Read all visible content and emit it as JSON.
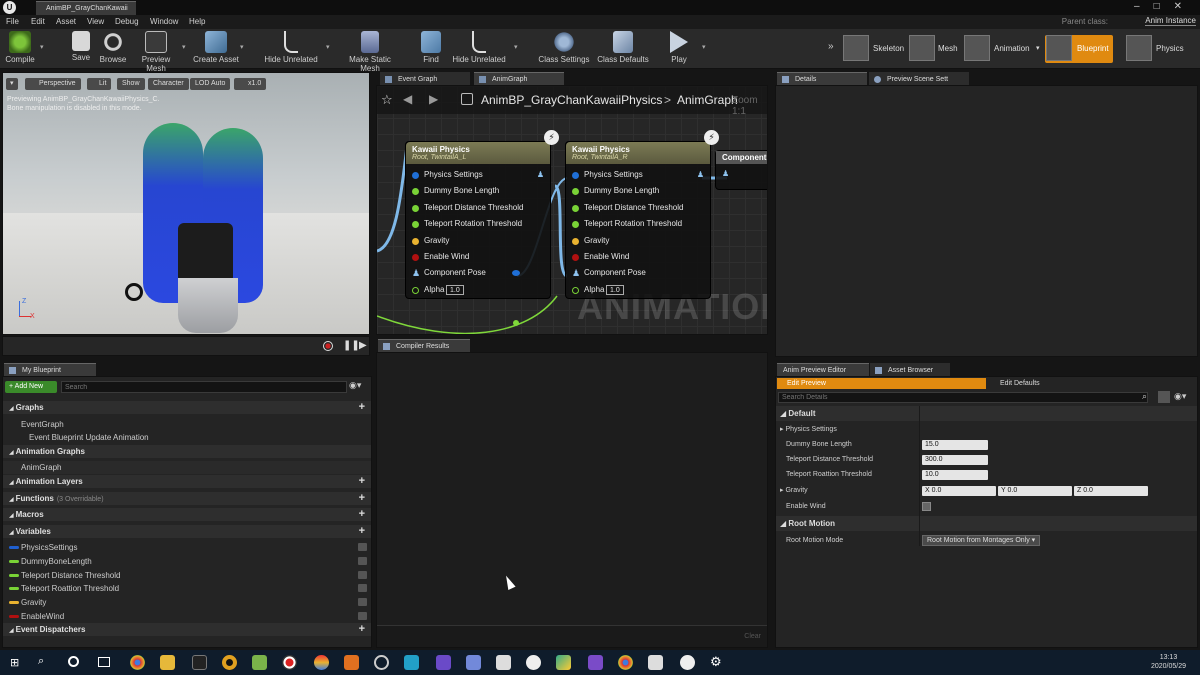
{
  "window": {
    "tab_title": "AnimBP_GrayChanKawaii",
    "parent_class_label": "Parent class:",
    "parent_class_value": "Anim Instance"
  },
  "menu": [
    "File",
    "Edit",
    "Asset",
    "View",
    "Debug",
    "Window",
    "Help"
  ],
  "toolbar": {
    "compile": "Compile",
    "save": "Save",
    "browse": "Browse",
    "preview_mesh": "Preview Mesh",
    "create_asset": "Create Asset",
    "hide_unrelated_1": "Hide Unrelated",
    "make_static_mesh": "Make Static Mesh",
    "find": "Find",
    "hide_unrelated_2": "Hide Unrelated",
    "class_settings": "Class Settings",
    "class_defaults": "Class Defaults",
    "play": "Play"
  },
  "modes": [
    "Skeleton",
    "Mesh",
    "Animation",
    "Blueprint",
    "Physics"
  ],
  "viewport": {
    "chips": [
      "Perspective",
      "Lit",
      "Show",
      "Character",
      "LOD Auto",
      "x1.0"
    ],
    "info_line1": "Previewing AnimBP_GrayChanKawaiiPhysics_C.",
    "info_line2": "Bone manipulation is disabled in this mode.",
    "axis_z": "Z",
    "axis_x": "X"
  },
  "graph": {
    "tab_event": "Event Graph",
    "tab_anim": "AnimGraph",
    "breadcrumb_bp": "AnimBP_GrayChanKawaiiPhysics",
    "breadcrumb_sep": ">",
    "breadcrumb_graph": "AnimGraph",
    "zoom": "Zoom 1:1",
    "watermark": "ANIMATION",
    "component_node": "Component T",
    "nodes": [
      {
        "title": "Kawaii Physics",
        "subtitle": "Root, TwintailA_L",
        "pins": [
          "Physics Settings",
          "Dummy Bone Length",
          "Teleport Distance Threshold",
          "Teleport Rotation Threshold",
          "Gravity",
          "Enable Wind",
          "Component Pose",
          "Alpha"
        ],
        "alpha": "1.0"
      },
      {
        "title": "Kawaii Physics",
        "subtitle": "Root, TwintailA_R",
        "pins": [
          "Physics Settings",
          "Dummy Bone Length",
          "Teleport Distance Threshold",
          "Teleport Rotation Threshold",
          "Gravity",
          "Enable Wind",
          "Component Pose",
          "Alpha"
        ],
        "alpha": "1.0"
      }
    ],
    "pin_colors": [
      "#1f6fd6",
      "#79d236",
      "#79d236",
      "#79d236",
      "#e8b230",
      "#b01010",
      "#8ec3f0",
      "#79d236"
    ]
  },
  "compiler": {
    "tab": "Compiler Results",
    "clear": "Clear"
  },
  "details": {
    "tab_details": "Details",
    "tab_preview": "Preview Scene Sett"
  },
  "mybp": {
    "tab": "My Blueprint",
    "add_new": "+ Add New",
    "search_placeholder": "Search",
    "rows": [
      {
        "type": "header",
        "label": "Graphs",
        "plus": true
      },
      {
        "type": "item",
        "label": "EventGraph"
      },
      {
        "type": "subitem",
        "label": "Event Blueprint Update Animation"
      },
      {
        "type": "header",
        "label": "Animation Graphs",
        "plus": false
      },
      {
        "type": "item",
        "label": "AnimGraph"
      },
      {
        "type": "header",
        "label": "Animation Layers",
        "plus": true
      },
      {
        "type": "header",
        "label": "Functions",
        "note": "(3 Overridable)",
        "plus": true
      },
      {
        "type": "header",
        "label": "Macros",
        "plus": true
      },
      {
        "type": "header",
        "label": "Variables",
        "plus": true
      },
      {
        "type": "var",
        "label": "PhysicsSettings",
        "color": "#1f5fcf"
      },
      {
        "type": "var",
        "label": "DummyBoneLength",
        "color": "#79d236"
      },
      {
        "type": "var",
        "label": "Teleport Distance Threshold",
        "color": "#79d236"
      },
      {
        "type": "var",
        "label": "Teleport Roattion Threshold",
        "color": "#79d236"
      },
      {
        "type": "var",
        "label": "Gravity",
        "color": "#e8b230"
      },
      {
        "type": "var",
        "label": "EnableWind",
        "color": "#b01010"
      },
      {
        "type": "header",
        "label": "Event Dispatchers",
        "plus": true
      }
    ]
  },
  "ape": {
    "tab_ape": "Anim Preview Editor",
    "tab_assets": "Asset Browser",
    "edit_preview": "Edit Preview",
    "edit_defaults": "Edit Defaults",
    "search_placeholder": "Search Details",
    "section_default": "Default",
    "physics_settings": "Physics Settings",
    "dummy_bone_length": "Dummy Bone Length",
    "dummy_bone_length_value": "15.0",
    "teleport_distance": "Teleport Distance Threshold",
    "teleport_distance_value": "300.0",
    "teleport_rotation": "Teleport Roattion Threshold",
    "teleport_rotation_value": "10.0",
    "gravity": "Gravity",
    "gravity_x": "X  0.0",
    "gravity_y": "Y  0.0",
    "gravity_z": "Z  0.0",
    "enable_wind": "Enable Wind",
    "section_root_motion": "Root Motion",
    "root_motion_mode": "Root Motion Mode",
    "root_motion_mode_value": "Root Motion from Montages Only"
  },
  "taskbar": {
    "time": "13:13",
    "date": "2020/05/29"
  }
}
